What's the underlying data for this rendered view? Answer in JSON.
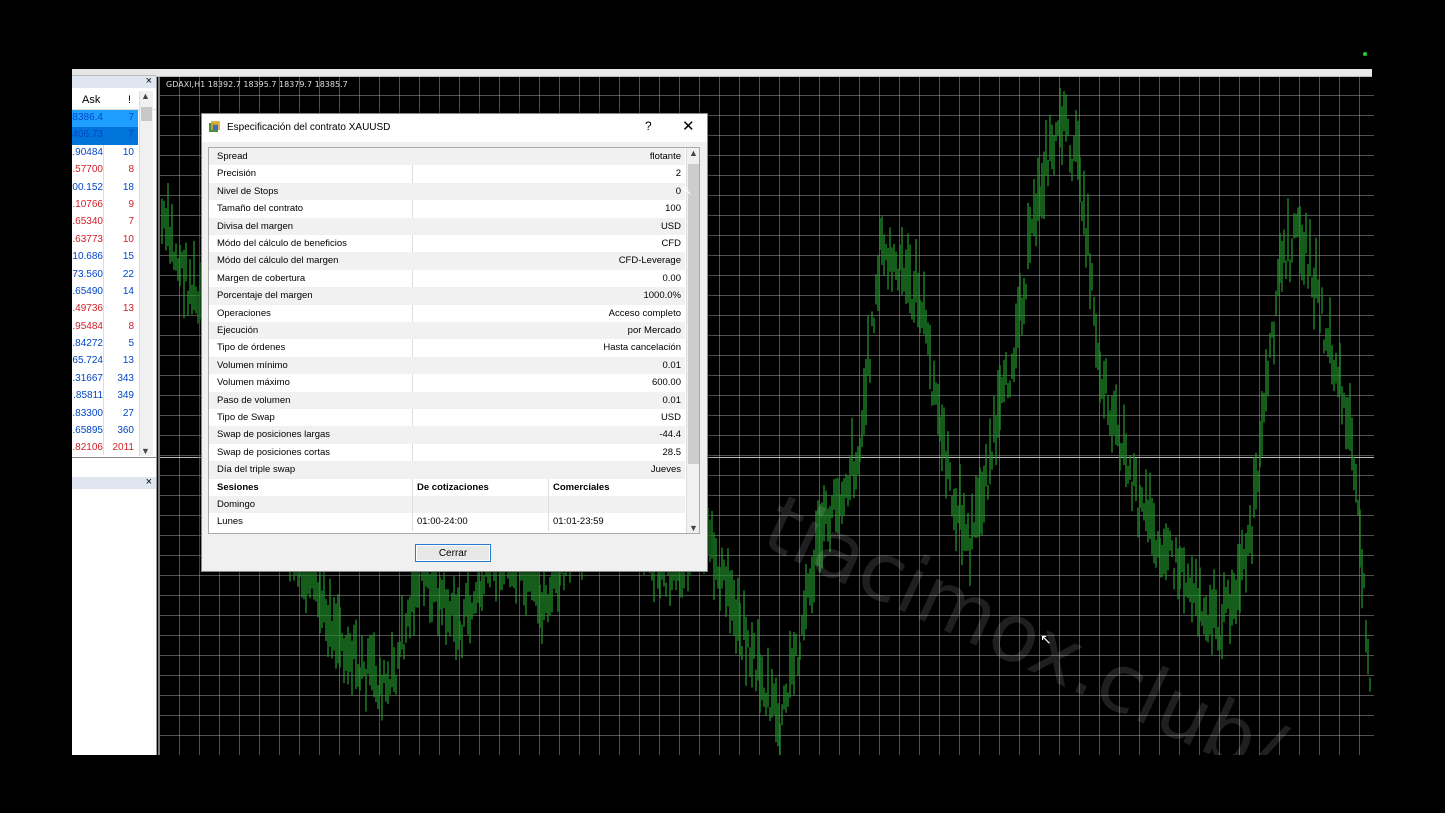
{
  "market_watch": {
    "col_ask": "Ask",
    "col_spread": "!",
    "close_glyph": "×",
    "rows": [
      {
        "ask": "8386.4",
        "spread": "7"
      },
      {
        "ask": "406.73",
        "spread": "7"
      },
      {
        "ask": ".90484",
        "spread": "10"
      },
      {
        "ask": ".57700",
        "spread": "8"
      },
      {
        "ask": "00.152",
        "spread": "18"
      },
      {
        "ask": ".10766",
        "spread": "9"
      },
      {
        "ask": ".65340",
        "spread": "7"
      },
      {
        "ask": ".63773",
        "spread": "10"
      },
      {
        "ask": "10.686",
        "spread": "15"
      },
      {
        "ask": "73.560",
        "spread": "22"
      },
      {
        "ask": ".65490",
        "spread": "14"
      },
      {
        "ask": ".49736",
        "spread": "13"
      },
      {
        "ask": ".95484",
        "spread": "8"
      },
      {
        "ask": ".84272",
        "spread": "5"
      },
      {
        "ask": "65.724",
        "spread": "13"
      },
      {
        "ask": ".31667",
        "spread": "343"
      },
      {
        "ask": ".85811",
        "spread": "349"
      },
      {
        "ask": ".83300",
        "spread": "27"
      },
      {
        "ask": ".65895",
        "spread": "360"
      },
      {
        "ask": ".82106",
        "spread": "2011"
      }
    ]
  },
  "chart": {
    "label": "GDAXI,H1  18392.7 18395.7 18379.7 18385.7",
    "watermark": "tiacimox.club/",
    "candle_color": "#1f8f2a"
  },
  "dialog": {
    "title": "Especificación del contrato XAUUSD",
    "help": "?",
    "close": "✕",
    "specs": [
      {
        "k": "Spread",
        "v": "flotante"
      },
      {
        "k": "Precisión",
        "v": "2"
      },
      {
        "k": "Nivel de Stops",
        "v": "0"
      },
      {
        "k": "Tamaño del contrato",
        "v": "100"
      },
      {
        "k": "Divisa del margen",
        "v": "USD"
      },
      {
        "k": "Módo del cálculo de beneficios",
        "v": "CFD"
      },
      {
        "k": "Módo del cálculo del margen",
        "v": "CFD-Leverage"
      },
      {
        "k": "Margen de cobertura",
        "v": "0.00"
      },
      {
        "k": "Porcentaje del margen",
        "v": "1000.0%"
      },
      {
        "k": "Operaciones",
        "v": "Acceso completo"
      },
      {
        "k": "Ejecución",
        "v": "por Mercado"
      },
      {
        "k": "Tipo de órdenes",
        "v": "Hasta cancelación"
      },
      {
        "k": "Volumen mínimo",
        "v": "0.01"
      },
      {
        "k": "Volumen máximo",
        "v": "600.00"
      },
      {
        "k": "Paso de volumen",
        "v": "0.01"
      },
      {
        "k": "Tipo de Swap",
        "v": "USD"
      },
      {
        "k": "Swap de posiciones largas",
        "v": "-44.4"
      },
      {
        "k": "Swap de posiciones cortas",
        "v": "28.5"
      },
      {
        "k": "Día del triple swap",
        "v": "Jueves"
      }
    ],
    "sessions_header": {
      "c1": "Sesiones",
      "c2": "De cotizaciones",
      "c3": "Comerciales"
    },
    "sessions": [
      {
        "day": "Domingo",
        "quotes": "",
        "trade": ""
      },
      {
        "day": "Lunes",
        "quotes": "01:00-24:00",
        "trade": "01:01-23:59"
      }
    ],
    "button_close": "Cerrar"
  }
}
